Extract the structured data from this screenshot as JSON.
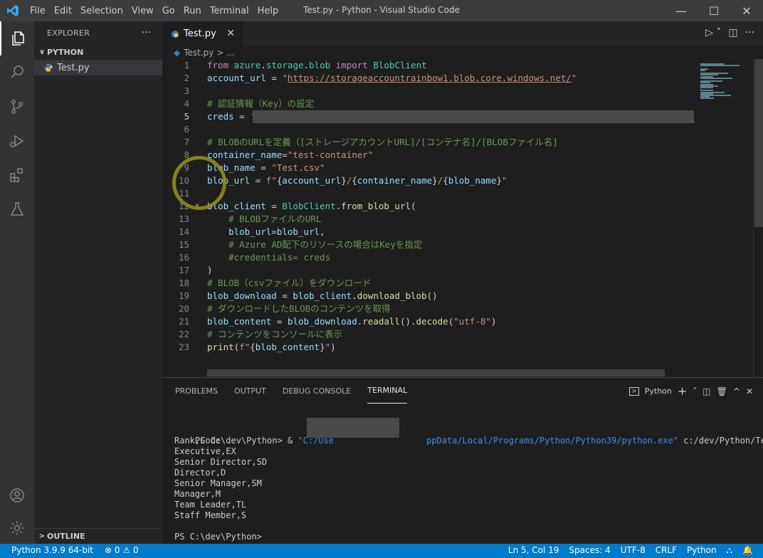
{
  "window": {
    "title": "Test.py - Python - Visual Studio Code",
    "menu": [
      "File",
      "Edit",
      "Selection",
      "View",
      "Go",
      "Run",
      "Terminal",
      "Help"
    ]
  },
  "sidebar": {
    "header": "EXPLORER",
    "more": "···",
    "section": "PYTHON",
    "file": "Test.py",
    "outline": "OUTLINE"
  },
  "tab": {
    "label": "Test.py"
  },
  "breadcrumb": {
    "file": "Test.py",
    "rest": "> ..."
  },
  "code_lines": [
    {
      "n": "1",
      "fold": "",
      "segs": [
        [
          "kw",
          "from "
        ],
        [
          "cls",
          "azure"
        ],
        [
          "op",
          "."
        ],
        [
          "cls",
          "storage"
        ],
        [
          "op",
          "."
        ],
        [
          "cls",
          "blob "
        ],
        [
          "kw",
          "import "
        ],
        [
          "cls",
          "BlobClient"
        ]
      ]
    },
    {
      "n": "2",
      "fold": "",
      "segs": [
        [
          "var",
          "account_url"
        ],
        [
          "op",
          " = "
        ],
        [
          "str",
          "\""
        ],
        [
          "url",
          "https://storageaccountrainbow1.blob.core.windows.net/"
        ],
        [
          "str",
          "\""
        ]
      ]
    },
    {
      "n": "3",
      "fold": "",
      "segs": []
    },
    {
      "n": "4",
      "fold": "",
      "segs": [
        [
          "cm",
          "# 認証情報（Key）の設定"
        ]
      ]
    },
    {
      "n": "5",
      "fold": "",
      "segs": [
        [
          "var",
          "creds"
        ],
        [
          "op",
          " = "
        ],
        [
          "str",
          "'"
        ]
      ]
    },
    {
      "n": "6",
      "fold": "",
      "segs": []
    },
    {
      "n": "7",
      "fold": "",
      "segs": [
        [
          "cm",
          "# BLOBのURLを定義（[ストレージアカウントURL]/[コンテナ名]/[BLOBファイル名]"
        ]
      ]
    },
    {
      "n": "8",
      "fold": "",
      "segs": [
        [
          "var",
          "container_name"
        ],
        [
          "op",
          "="
        ],
        [
          "str",
          "\"test-container\""
        ]
      ]
    },
    {
      "n": "9",
      "fold": "",
      "segs": [
        [
          "var",
          "blob_name"
        ],
        [
          "op",
          " = "
        ],
        [
          "str",
          "\"Test.csv\""
        ]
      ]
    },
    {
      "n": "10",
      "fold": "",
      "segs": [
        [
          "var",
          "blob_url"
        ],
        [
          "op",
          " = "
        ],
        [
          "kw",
          "f"
        ],
        [
          "str",
          "\""
        ],
        [
          "op",
          "{"
        ],
        [
          "var",
          "account_url"
        ],
        [
          "op",
          "}"
        ],
        [
          "str",
          "/"
        ],
        [
          "op",
          "{"
        ],
        [
          "var",
          "container_name"
        ],
        [
          "op",
          "}"
        ],
        [
          "str",
          "/"
        ],
        [
          "op",
          "{"
        ],
        [
          "var",
          "blob_name"
        ],
        [
          "op",
          "}"
        ],
        [
          "str",
          "\""
        ]
      ]
    },
    {
      "n": "11",
      "fold": "",
      "segs": []
    },
    {
      "n": "12",
      "fold": "∨",
      "segs": [
        [
          "var",
          "blob_client"
        ],
        [
          "op",
          " = "
        ],
        [
          "cls",
          "BlobClient"
        ],
        [
          "op",
          "."
        ],
        [
          "fn",
          "from_blob_url"
        ],
        [
          "op",
          "("
        ]
      ]
    },
    {
      "n": "13",
      "fold": "",
      "segs": [
        [
          "op",
          "    "
        ],
        [
          "cm",
          "# BLOBファイルのURL"
        ]
      ]
    },
    {
      "n": "14",
      "fold": "",
      "segs": [
        [
          "op",
          "    "
        ],
        [
          "var",
          "blob_url"
        ],
        [
          "op",
          "="
        ],
        [
          "var",
          "blob_url"
        ],
        [
          "op",
          ","
        ]
      ]
    },
    {
      "n": "15",
      "fold": "",
      "segs": [
        [
          "op",
          "    "
        ],
        [
          "cm",
          "# Azure AD配下のリソースの場合はKeyを指定"
        ]
      ]
    },
    {
      "n": "16",
      "fold": "",
      "segs": [
        [
          "op",
          "    "
        ],
        [
          "cm",
          "#credentials= creds"
        ]
      ]
    },
    {
      "n": "17",
      "fold": "",
      "segs": [
        [
          "op",
          ")"
        ]
      ]
    },
    {
      "n": "18",
      "fold": "",
      "segs": [
        [
          "cm",
          "# BLOB（csvファイル）をダウンロード"
        ]
      ]
    },
    {
      "n": "19",
      "fold": "",
      "segs": [
        [
          "var",
          "blob_download"
        ],
        [
          "op",
          " = "
        ],
        [
          "var",
          "blob_client"
        ],
        [
          "op",
          "."
        ],
        [
          "fn",
          "download_blob"
        ],
        [
          "op",
          "()"
        ]
      ]
    },
    {
      "n": "20",
      "fold": "",
      "segs": [
        [
          "cm",
          "# ダウンロードしたBLOBのコンテンツを取得"
        ]
      ]
    },
    {
      "n": "21",
      "fold": "",
      "segs": [
        [
          "var",
          "blob_content"
        ],
        [
          "op",
          " = "
        ],
        [
          "var",
          "blob_download"
        ],
        [
          "op",
          "."
        ],
        [
          "fn",
          "readall"
        ],
        [
          "op",
          "()."
        ],
        [
          "fn",
          "decode"
        ],
        [
          "op",
          "("
        ],
        [
          "str",
          "\"utf-8\""
        ],
        [
          "op",
          ")"
        ]
      ]
    },
    {
      "n": "22",
      "fold": "",
      "segs": [
        [
          "cm",
          "# コンテンツをコンソールに表示"
        ]
      ]
    },
    {
      "n": "23",
      "fold": "",
      "segs": [
        [
          "fn",
          "print"
        ],
        [
          "op",
          "("
        ],
        [
          "kw",
          "f"
        ],
        [
          "str",
          "\""
        ],
        [
          "op",
          "{"
        ],
        [
          "var",
          "blob_content"
        ],
        [
          "op",
          "}"
        ],
        [
          "str",
          "\""
        ],
        [
          "op",
          ")"
        ]
      ]
    }
  ],
  "panel": {
    "tabs": [
      "PROBLEMS",
      "OUTPUT",
      "DEBUG CONSOLE",
      "TERMINAL"
    ],
    "active_tab": "TERMINAL",
    "shell": "Python"
  },
  "terminal": {
    "cmd_prefix": "PS C:\\dev\\Python> & ",
    "cmd_path_start": "\"C:/Use",
    "cmd_path_end": "ppData/Local/Programs/Python/Python39/python.exe\"",
    "cmd_arg": " c:/dev/Python/Test.py",
    "output": [
      "Rank,Code",
      "Executive,EX",
      "Senior Director,SD",
      "Director,D",
      "Senior Manager,SM",
      "Manager,M",
      "Team Leader,TL",
      "Staff Member,S"
    ],
    "prompt": "PS C:\\dev\\Python>"
  },
  "status": {
    "interpreter": "Python 3.9.9 64-bit",
    "errors": "0",
    "warnings": "0",
    "position": "Ln 5, Col 19",
    "spaces": "Spaces: 4",
    "encoding": "UTF-8",
    "eol": "CRLF",
    "language": "Python"
  }
}
